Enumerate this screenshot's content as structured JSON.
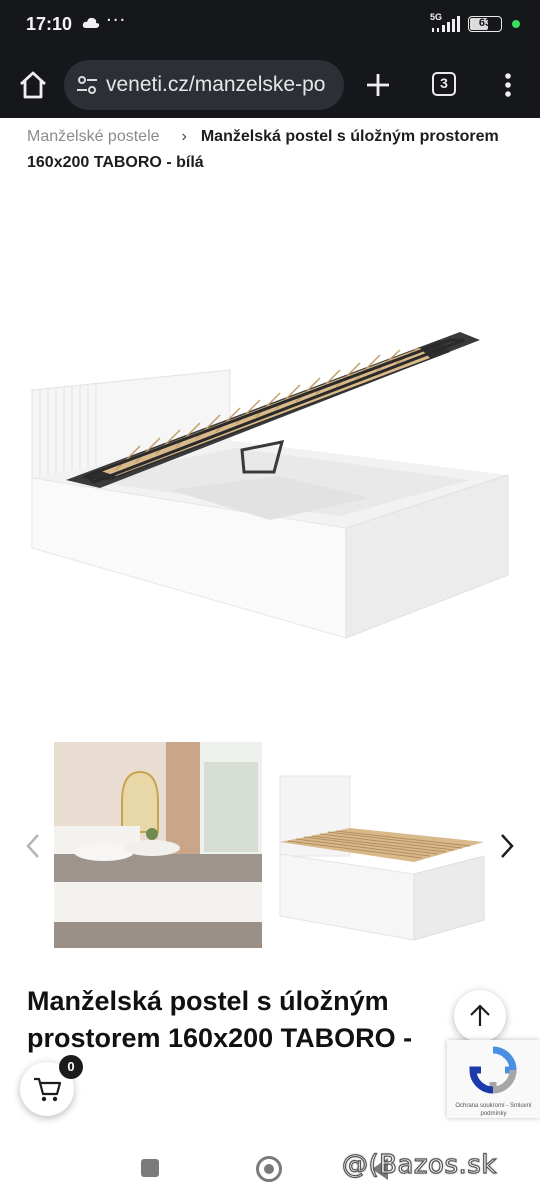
{
  "status_bar": {
    "time": "17:10",
    "dots": "···",
    "network": "5G",
    "battery": "63",
    "battery_level": 0.63
  },
  "browser": {
    "url": "veneti.cz/manzelske-po",
    "tab_count": "3"
  },
  "breadcrumb": {
    "parent": "Manželské postele",
    "separator": "›",
    "current": "Manželská postel s úložným prostorem 160x200 TABORO - bílá"
  },
  "product": {
    "title": "Manželská postel s úložným prostorem 160x200 TABORO -"
  },
  "cart": {
    "count": "0"
  },
  "recaptcha": {
    "text": "Ochrana soukromí - Smluvní podmínky"
  },
  "watermark": "@(Bazos.sk",
  "colors": {
    "browser_bg": "#16171b",
    "url_bar_bg": "#2c2f36",
    "slat_wood": "#d8b98a",
    "frame_dark": "#3a3a3a",
    "bed_white": "#f4f4f4"
  }
}
